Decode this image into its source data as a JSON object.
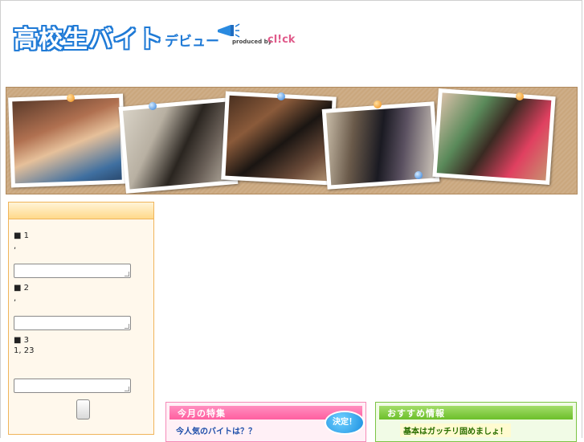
{
  "header": {
    "top_text": "",
    "logo": {
      "main": "高校生バイト",
      "sub": "デビュー",
      "produced_by": "produced by",
      "brand": "cl!ck"
    },
    "top_right_link": "",
    "nav_text": " "
  },
  "hero": {
    "photos": [
      "friends-photo",
      "phone-call-photo",
      "cafe-photo",
      "students-walking-photo",
      "shopping-photo"
    ]
  },
  "survey": {
    "title": "",
    "questions": [
      {
        "label": "■ 1",
        "text": "",
        "hint": ", "
      },
      {
        "label": "■ 2",
        "text": "",
        "hint": ", "
      },
      {
        "label": "■ 3",
        "text": "",
        "hint": "1, 23"
      }
    ],
    "submit_label": ""
  },
  "feature": {
    "title": "今月の特集",
    "subtitle": "今人気のバイトは？？",
    "badge": "決定！"
  },
  "recommend": {
    "title": "おすすめ情報",
    "subtitle": "基本はガッチリ固めましょ！"
  },
  "colors": {
    "accent_orange": "#f0a030",
    "accent_blue": "#1f7ad6",
    "pink": "#ff5fa0",
    "green": "#6cbf2a"
  }
}
